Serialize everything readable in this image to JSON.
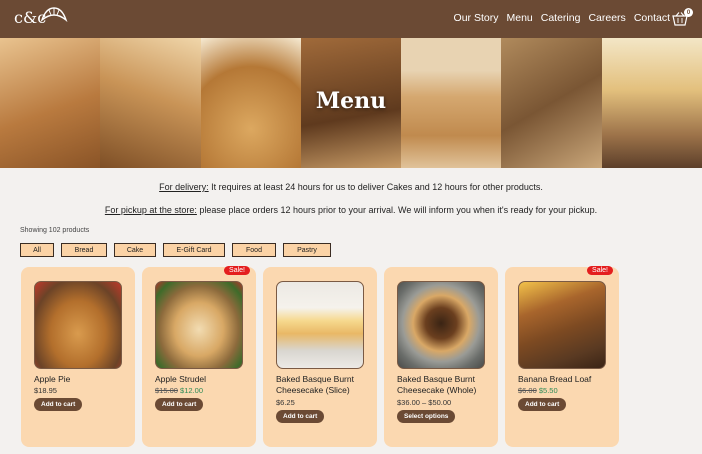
{
  "header": {
    "logo_text": "c&c",
    "nav": [
      "Our Story",
      "Menu",
      "Catering",
      "Careers",
      "Contact"
    ],
    "cart_count": "0",
    "colors": {
      "brand": "#6b4a34"
    }
  },
  "hero": {
    "title": "Menu"
  },
  "info": {
    "delivery_label": "For delivery:",
    "delivery_text": " It requires at least 24 hours for us to deliver Cakes and 12 hours for other products.",
    "pickup_label": "For pickup at the store:",
    "pickup_text": " please place orders 12 hours prior to your arrival. We will inform you when it's ready for your pickup."
  },
  "results_count": "Showing 102 products",
  "filters": [
    "All",
    "Bread",
    "Cake",
    "E-Gift Card",
    "Food",
    "Pastry"
  ],
  "products": [
    {
      "name": "Apple Pie",
      "price": "$18.95",
      "button": "Add to cart",
      "badge": ""
    },
    {
      "name": "Apple Strudel",
      "old_price": "$15.00",
      "new_price": "$12.00",
      "button": "Add to cart",
      "badge": "Sale!"
    },
    {
      "name": "Baked Basque Burnt Cheesecake (Slice)",
      "price": "$6.25",
      "button": "Add to cart",
      "badge": ""
    },
    {
      "name": "Baked Basque Burnt Cheesecake (Whole)",
      "price": "$36.00 – $50.00",
      "button": "Select options",
      "badge": ""
    },
    {
      "name": "Banana Bread Loaf",
      "old_price": "$6.00",
      "new_price": "$5.50",
      "button": "Add to cart",
      "badge": "Sale!"
    }
  ]
}
